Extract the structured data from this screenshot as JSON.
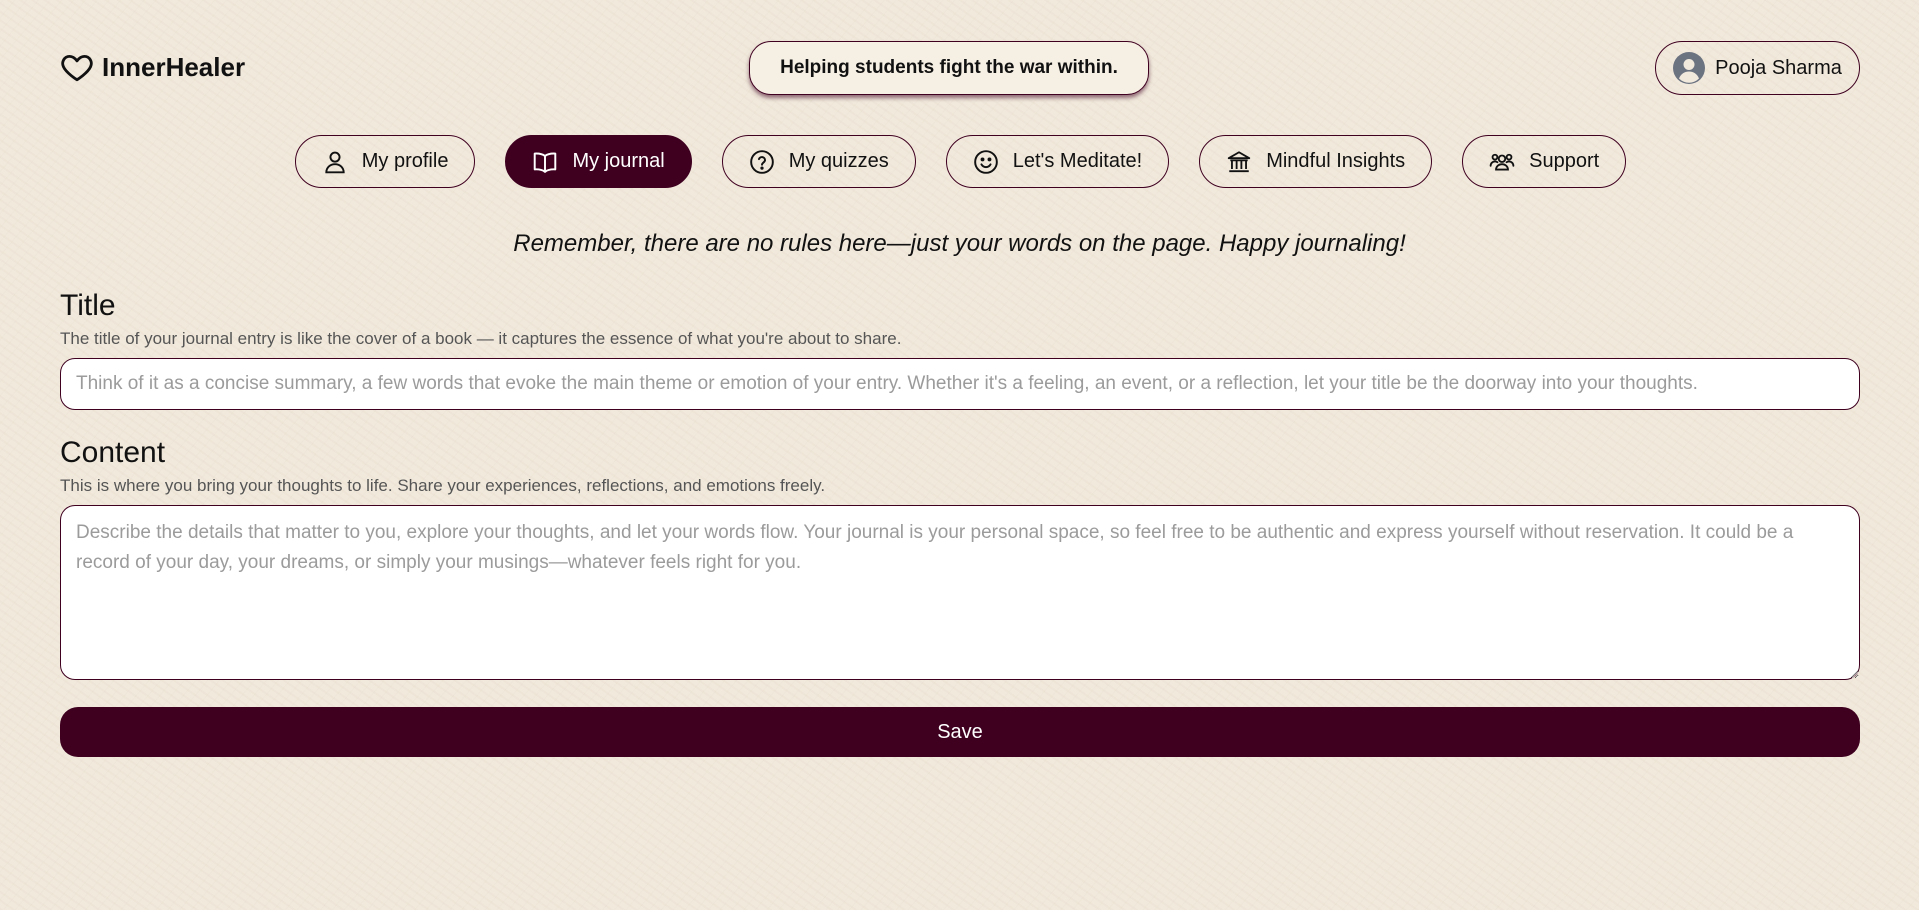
{
  "app": {
    "name": "InnerHealer",
    "logo_icon": "heart-icon"
  },
  "header": {
    "tagline": "Helping students fight the war within.",
    "user_name": "Pooja Sharma"
  },
  "nav": {
    "items": [
      {
        "label": "My profile",
        "icon": "user-icon",
        "active": false
      },
      {
        "label": "My journal",
        "icon": "book-icon",
        "active": true
      },
      {
        "label": "My quizzes",
        "icon": "question-icon",
        "active": false
      },
      {
        "label": "Let's Meditate!",
        "icon": "smile-icon",
        "active": false
      },
      {
        "label": "Mindful Insights",
        "icon": "library-icon",
        "active": false
      },
      {
        "label": "Support",
        "icon": "users-icon",
        "active": false
      }
    ]
  },
  "quote": "Remember, there are no rules here—just your words on the page. Happy journaling!",
  "title_section": {
    "heading": "Title",
    "description": "The title of your journal entry is like the cover of a book — it captures the essence of what you're about to share.",
    "value": "",
    "placeholder": "Think of it as a concise summary, a few words that evoke the main theme or emotion of your entry. Whether it's a feeling, an event, or a reflection, let your title be the doorway into your thoughts."
  },
  "content_section": {
    "heading": "Content",
    "description": "This is where you bring your thoughts to life. Share your experiences, reflections, and emotions freely.",
    "value": "",
    "placeholder": "Describe the details that matter to you, explore your thoughts, and let your words flow. Your journal is your personal space, so feel free to be authentic and express yourself without reservation. It could be a record of your day, your dreams, or simply your musings—whatever feels right for you."
  },
  "save_label": "Save",
  "colors": {
    "accent": "#3f0020",
    "background": "#f1e9dc"
  }
}
